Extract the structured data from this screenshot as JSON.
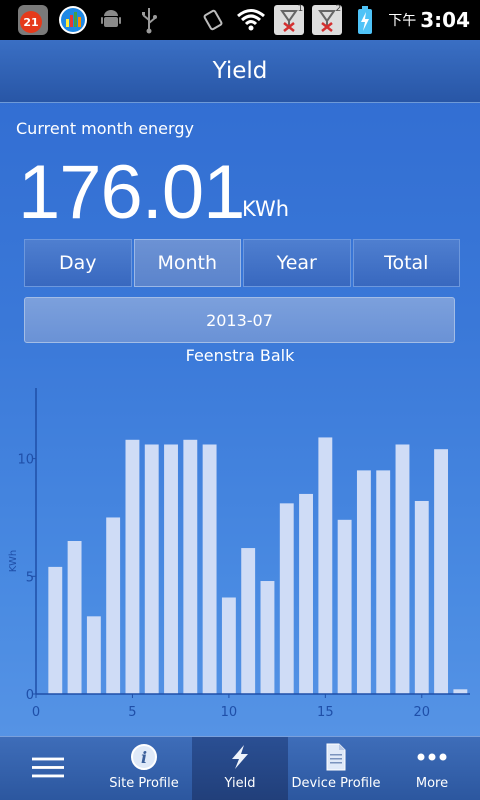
{
  "status_bar": {
    "notification_count": "21",
    "time_prefix": "下午",
    "time": "3:04",
    "sim1_label": "1",
    "sim2_label": "2"
  },
  "header": {
    "title": "Yield"
  },
  "energy": {
    "label": "Current month energy",
    "value": "176.01",
    "unit": "KWh"
  },
  "tabs": [
    {
      "label": "Day",
      "active": false
    },
    {
      "label": "Month",
      "active": true
    },
    {
      "label": "Year",
      "active": false
    },
    {
      "label": "Total",
      "active": false
    }
  ],
  "date_selector": {
    "value": "2013-07"
  },
  "site": {
    "name": "Feenstra Balk"
  },
  "chart_data": {
    "type": "bar",
    "ylabel": "KWh",
    "xlim": [
      0,
      22.5
    ],
    "ylim": [
      0,
      13
    ],
    "x_ticks": [
      0,
      5,
      10,
      15,
      20
    ],
    "y_ticks": [
      0,
      5,
      10
    ],
    "bar_color": "#cfdcf6",
    "axis_color": "#1f4fa8",
    "x": [
      1,
      2,
      3,
      4,
      5,
      6,
      7,
      8,
      9,
      10,
      11,
      12,
      13,
      14,
      15,
      16,
      17,
      18,
      19,
      20,
      21,
      22
    ],
    "values": [
      5.4,
      6.5,
      3.3,
      7.5,
      10.8,
      10.6,
      10.6,
      10.8,
      10.6,
      4.1,
      6.2,
      4.8,
      8.1,
      8.5,
      10.9,
      7.4,
      9.5,
      9.5,
      10.6,
      8.2,
      10.4,
      0.2
    ]
  },
  "bottom_nav": [
    {
      "label": "",
      "icon": "menu-icon",
      "active": false
    },
    {
      "label": "Site Profile",
      "icon": "info-icon",
      "active": false
    },
    {
      "label": "Yield",
      "icon": "lightning-icon",
      "active": true
    },
    {
      "label": "Device Profile",
      "icon": "document-icon",
      "active": false
    },
    {
      "label": "More",
      "icon": "more-icon",
      "active": false
    }
  ]
}
